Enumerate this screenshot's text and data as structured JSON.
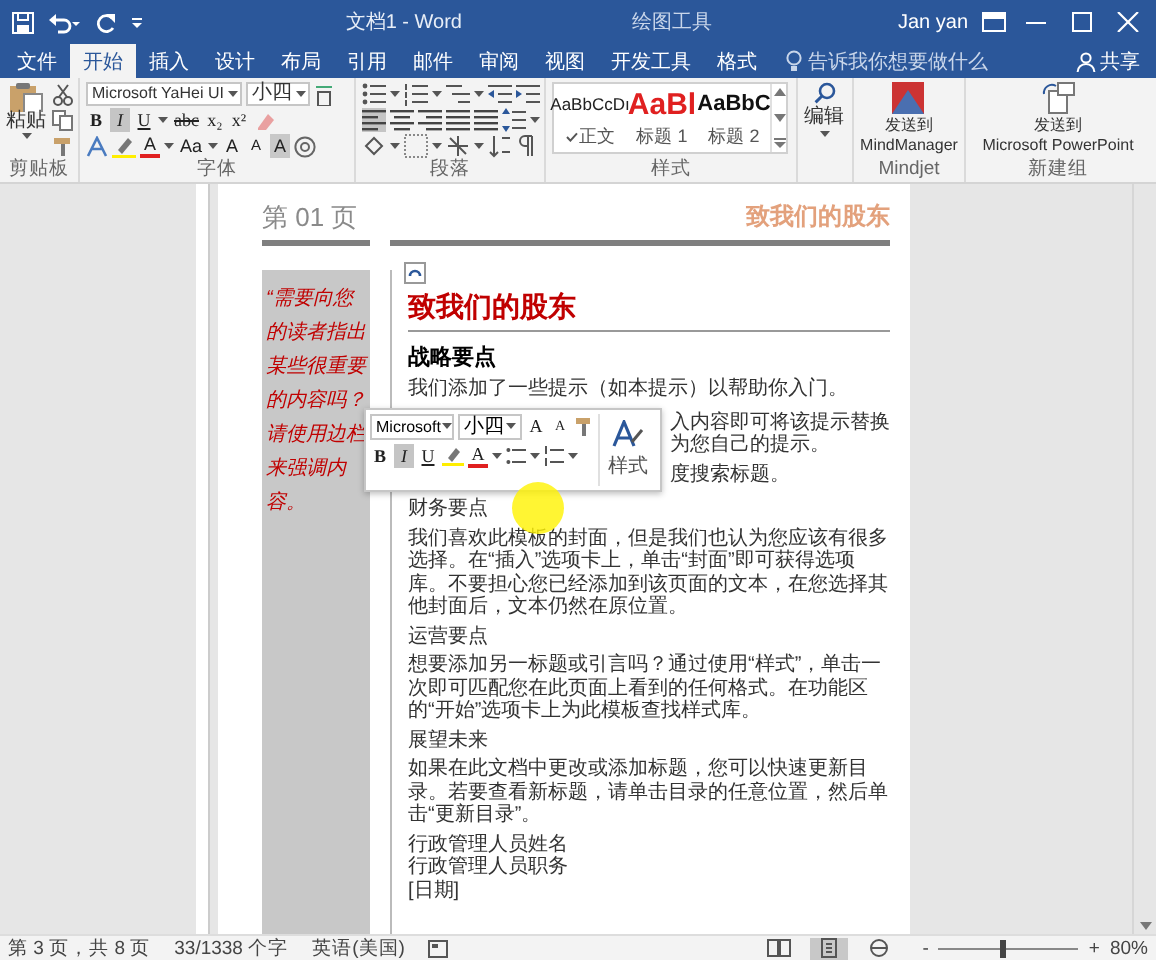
{
  "title_bar": {
    "title": "文档1 - Word",
    "context_label": "绘图工具",
    "user": "Jan yan"
  },
  "tabs": [
    {
      "label": "文件",
      "selected": false
    },
    {
      "label": "开始",
      "selected": true
    },
    {
      "label": "插入",
      "selected": false
    },
    {
      "label": "设计",
      "selected": false
    },
    {
      "label": "布局",
      "selected": false
    },
    {
      "label": "引用",
      "selected": false
    },
    {
      "label": "邮件",
      "selected": false
    },
    {
      "label": "审阅",
      "selected": false
    },
    {
      "label": "视图",
      "selected": false
    },
    {
      "label": "开发工具",
      "selected": false
    },
    {
      "label": "格式",
      "selected": false
    }
  ],
  "tell_me": {
    "placeholder": "告诉我你想要做什么"
  },
  "share": "共享",
  "ribbon": {
    "clipboard": {
      "label": "剪贴板",
      "paste": "粘贴"
    },
    "font": {
      "label": "字体",
      "font_name": "Microsoft YaHei UI",
      "font_size": "小四",
      "buttons": [
        {
          "label": "B",
          "on": false
        },
        {
          "label": "I",
          "on": true
        },
        {
          "label": "U",
          "on": false
        },
        {
          "label": "abc",
          "on": false
        },
        {
          "label": "x₂",
          "on": false
        },
        {
          "label": "x²",
          "on": false
        }
      ],
      "color_letter": "A",
      "case_label": "Aa",
      "grow_letter": "A",
      "shrink_letter": "A",
      "shading_letter": "A"
    },
    "paragraph": {
      "label": "段落",
      "alignment": [
        {
          "kind": "left",
          "selected": true
        },
        {
          "kind": "center",
          "selected": false
        },
        {
          "kind": "right",
          "selected": false
        },
        {
          "kind": "justify",
          "selected": false
        },
        {
          "kind": "distributed",
          "selected": false
        }
      ]
    },
    "styles": {
      "label": "样式",
      "items": [
        {
          "sample": "AaBbCcDı",
          "name": "正文",
          "kind": "normal",
          "selected": true
        },
        {
          "sample": "AaBl",
          "name": "标题 1",
          "kind": "heading1",
          "selected": false
        },
        {
          "sample": "AaBbC",
          "name": "标题 2",
          "kind": "heading2",
          "selected": false
        }
      ]
    },
    "editing": {
      "button": "编辑"
    },
    "mindjet": {
      "label": "Mindjet",
      "lines": [
        "发送到",
        "MindManager"
      ]
    },
    "new_group": {
      "label": "新建组",
      "lines": [
        "发送到",
        "Microsoft PowerPoint"
      ]
    }
  },
  "document": {
    "header": {
      "page_number": "第 01 页",
      "title": "致我们的股东"
    },
    "sidebar_quote": "“需要向您的读者指出某些很重要的内容吗？请使用边栏来强调内容。",
    "heading": "致我们的股东",
    "blocks": [
      {
        "kind": "subheading",
        "text": "战略要点"
      },
      {
        "kind": "paragraph",
        "text": "我们添加了一些提示（如本提示）以帮助你入门。"
      },
      {
        "kind": "mini_toolbar",
        "font_name": "Microsoft",
        "font_size": "小四",
        "grow_letter": "A",
        "shrink_letter": "A",
        "buttons": [
          {
            "label": "B",
            "on": false
          },
          {
            "label": "I",
            "on": true
          },
          {
            "label": "U",
            "on": false
          }
        ],
        "color_letter": "A",
        "styles_label": "样式",
        "fragments": [
          "入内容即可将该提示替换为您自己的提示。",
          "度搜索标题。"
        ]
      },
      {
        "kind": "subheading_plain",
        "text": "财务要点"
      },
      {
        "kind": "paragraph",
        "text": "我们喜欢此模板的封面，但是我们也认为您应该有很多选择。在“插入”选项卡上，单击“封面”即可获得选项库。不要担心您已经添加到该页面的文本，在您选择其他封面后，文本仍然在原位置。"
      },
      {
        "kind": "subheading_plain",
        "text": "运营要点"
      },
      {
        "kind": "paragraph",
        "text": "想要添加另一标题或引言吗？通过使用“样式”，单击一次即可匹配您在此页面上看到的任何格式。在功能区的“开始”选项卡上为此模板查找样式库。"
      },
      {
        "kind": "subheading_plain",
        "text": "展望未来"
      },
      {
        "kind": "paragraph",
        "text": "如果在此文档中更改或添加标题，您可以快速更新目录。若要查看新标题，请单击目录的任意位置，然后单击“更新目录”。"
      },
      {
        "kind": "line",
        "text": "行政管理人员姓名"
      },
      {
        "kind": "line",
        "text": "行政管理人员职务"
      },
      {
        "kind": "line",
        "text": "[日期]"
      }
    ]
  },
  "status_bar": {
    "page": "第 3 页，共 8 页",
    "words": "33/1338 个字",
    "language": "英语(美国)",
    "views": [
      {
        "kind": "read",
        "selected": false
      },
      {
        "kind": "print",
        "selected": true
      },
      {
        "kind": "web",
        "selected": false
      }
    ],
    "zoom": {
      "minus": "-",
      "plus": "+",
      "level": 0.45,
      "reading": "80%"
    }
  }
}
